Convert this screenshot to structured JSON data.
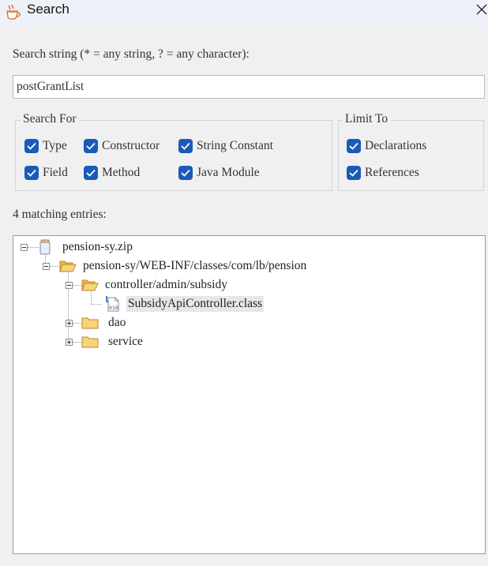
{
  "window": {
    "title": "Search",
    "app_icon": "coffee-cup-icon",
    "close_icon": "close-icon"
  },
  "search": {
    "label": "Search string (* = any string, ? = any character):",
    "value": "postGrantList"
  },
  "search_for": {
    "title": "Search For",
    "options": [
      {
        "label": "Type",
        "checked": true
      },
      {
        "label": "Constructor",
        "checked": true
      },
      {
        "label": "String Constant",
        "checked": true
      },
      {
        "label": "Field",
        "checked": true
      },
      {
        "label": "Method",
        "checked": true
      },
      {
        "label": "Java Module",
        "checked": true
      }
    ]
  },
  "limit_to": {
    "title": "Limit To",
    "options": [
      {
        "label": "Declarations",
        "checked": true
      },
      {
        "label": "References",
        "checked": true
      }
    ]
  },
  "results": {
    "count_label": "4 matching entries:",
    "tree": [
      {
        "label": "pension-sy.zip",
        "icon": "jar-icon",
        "expanded": true
      },
      {
        "label": "pension-sy/WEB-INF/classes/com/lb/pension",
        "icon": "folder-open-icon",
        "expanded": true
      },
      {
        "label": "controller/admin/subsidy",
        "icon": "folder-open-icon",
        "expanded": true
      },
      {
        "label": "SubsidyApiController.class",
        "icon": "class-file-icon",
        "selected": true
      },
      {
        "label": "dao",
        "icon": "folder-icon",
        "expanded": false
      },
      {
        "label": "service",
        "icon": "folder-icon",
        "expanded": false
      }
    ]
  },
  "colors": {
    "checkbox": "#1a5bb8",
    "folder": "#f5c451",
    "selection": "#e7e7e7"
  }
}
